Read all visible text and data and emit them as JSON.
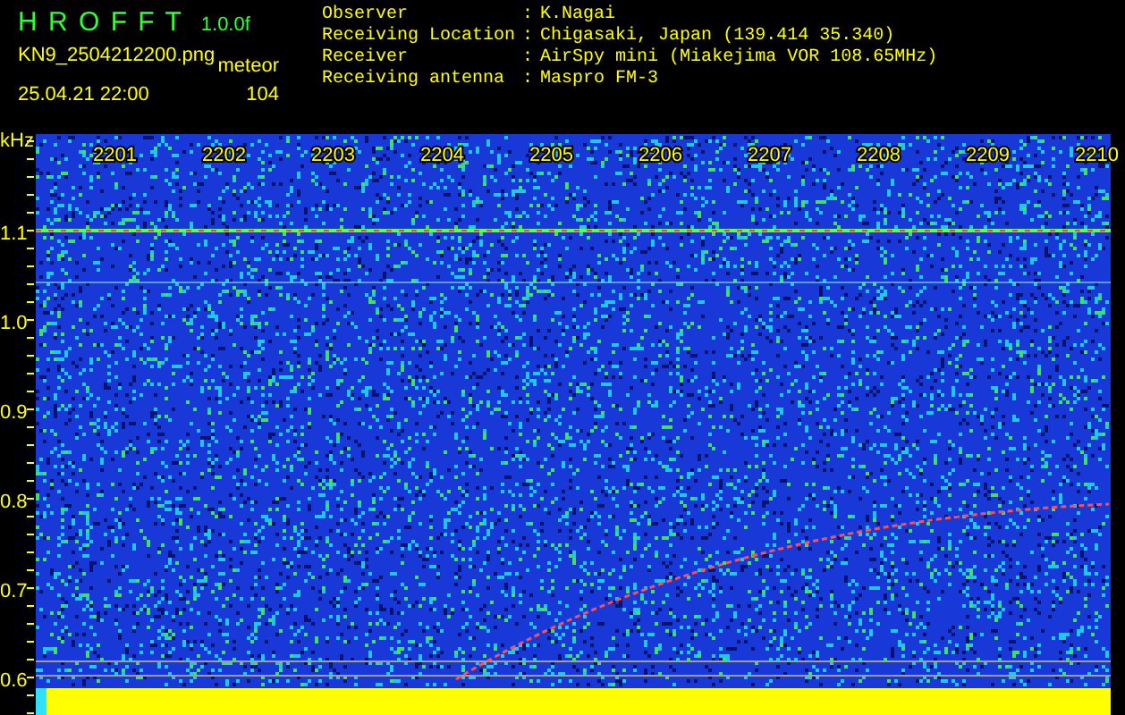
{
  "header": {
    "title": "H R O F F T",
    "version": "1.0.0f",
    "filename": "KN9_2504212200.png",
    "mode": "meteor",
    "datetime": "25.04.21 22:00",
    "count": "104"
  },
  "info": [
    {
      "label": "Observer",
      "separator": ":",
      "value": "K.Nagai"
    },
    {
      "label": "Receiving Location",
      "separator": ":",
      "value": "Chigasaki, Japan (139.414 35.340)"
    },
    {
      "label": "Receiver",
      "separator": ":",
      "value": "AirSpy mini (Miakejima VOR 108.65MHz)"
    },
    {
      "label": "Receiving antenna",
      "separator": ":",
      "value": "Maspro FM-3"
    }
  ],
  "spectrogram": {
    "unit": "kHz",
    "x_labels": [
      "2201",
      "2202",
      "2203",
      "2204",
      "2205",
      "2206",
      "2207",
      "2208",
      "2209",
      "2210"
    ],
    "y_labels": [
      "1.1",
      "1.0",
      "0.9",
      "0.8",
      "0.7",
      "0.6"
    ]
  }
}
